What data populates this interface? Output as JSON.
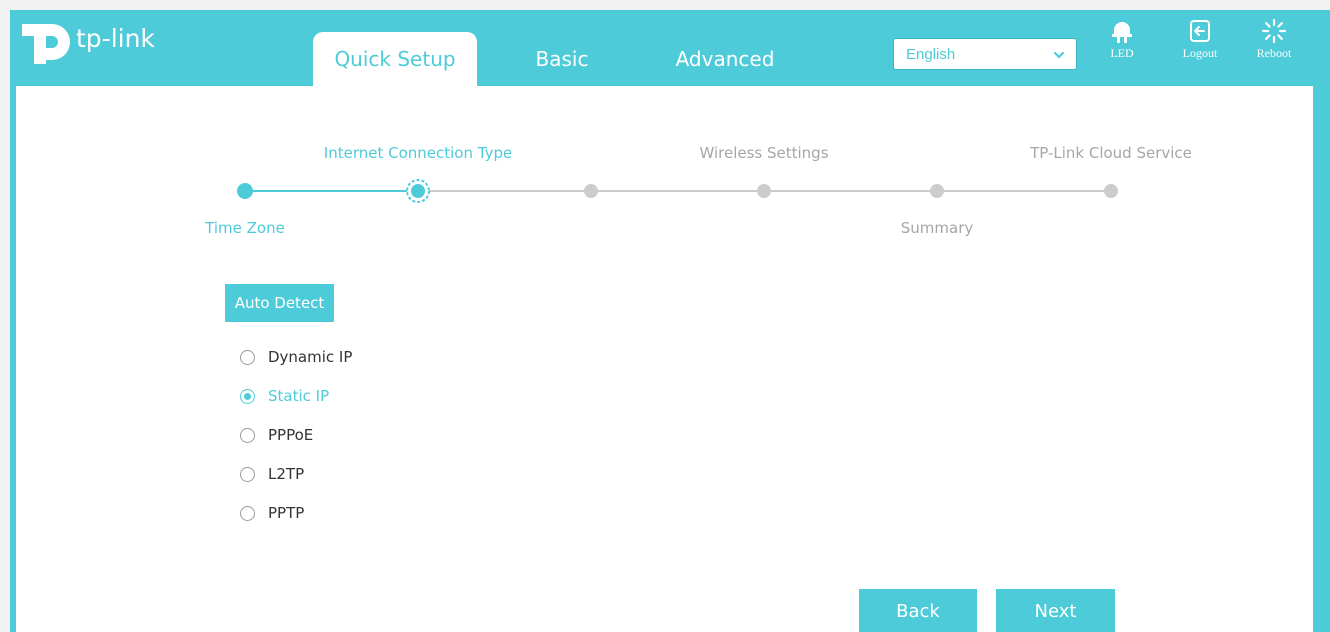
{
  "brand": {
    "name": "tp-link"
  },
  "nav": {
    "tabs": [
      {
        "label": "Quick Setup",
        "active": true
      },
      {
        "label": "Basic",
        "active": false
      },
      {
        "label": "Advanced",
        "active": false
      }
    ],
    "language": {
      "selected": "English"
    },
    "buttons": [
      {
        "label": "LED",
        "icon": "led-bulb-icon"
      },
      {
        "label": "Logout",
        "icon": "logout-icon"
      },
      {
        "label": "Reboot",
        "icon": "reboot-icon"
      }
    ]
  },
  "steps": [
    {
      "label": "Time Zone",
      "state": "done"
    },
    {
      "label": "Internet Connection Type",
      "state": "current"
    },
    {
      "label": "",
      "state": "pending"
    },
    {
      "label": "Wireless Settings",
      "state": "pending"
    },
    {
      "label": "Summary",
      "state": "pending"
    },
    {
      "label": "TP-Link Cloud Service",
      "state": "pending"
    }
  ],
  "connection": {
    "auto_detect_label": "Auto Detect",
    "options": [
      {
        "label": "Dynamic IP",
        "checked": false
      },
      {
        "label": "Static IP",
        "checked": true
      },
      {
        "label": "PPPoE",
        "checked": false
      },
      {
        "label": "L2TP",
        "checked": false
      },
      {
        "label": "PPTP",
        "checked": false
      }
    ]
  },
  "actions": {
    "back_label": "Back",
    "next_label": "Next"
  },
  "colors": {
    "accent": "#4ecbd8",
    "inactive": "#cccccc",
    "text": "#333333",
    "muted": "#a6a6a6"
  }
}
